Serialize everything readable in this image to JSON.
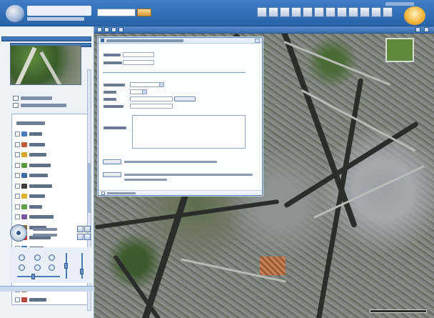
{
  "header": {
    "search_value": "",
    "search_go_label": "",
    "logo_icon": "earth-logo-icon",
    "tool_icons": [
      "map-tool-icon",
      "pencil-tool-icon",
      "layers-tool-icon",
      "print-tool-icon",
      "measure-tool-icon",
      "info-tool-icon",
      "route-tool-icon",
      "identify-tool-icon",
      "export-tool-icon",
      "help-tool-icon",
      "window-tool-icon",
      "settings-tool-icon"
    ]
  },
  "map_toolbar": {
    "buttons": [
      "first",
      "prev",
      "next",
      "last",
      "refresh",
      "close"
    ]
  },
  "sidebar": {
    "overview_title": "",
    "overview_options": [
      "",
      ""
    ],
    "layers_title": "",
    "layers": [
      {
        "icon": "home-icon",
        "color": "#4d7bbd"
      },
      {
        "icon": "building-icon",
        "color": "#c05b3a"
      },
      {
        "icon": "star-icon",
        "color": "#d9a42b"
      },
      {
        "icon": "flag-icon",
        "color": "#5a9a3c"
      },
      {
        "icon": "ship-icon",
        "color": "#3a6aa8"
      },
      {
        "icon": "plane-icon",
        "color": "#3d3d3d"
      },
      {
        "icon": "triangle-icon",
        "color": "#e0b233"
      },
      {
        "icon": "leaf-icon",
        "color": "#5fa04a"
      },
      {
        "icon": "tower-icon",
        "color": "#7a5a9e"
      },
      {
        "icon": "book-icon",
        "color": "#8b6a3a"
      },
      {
        "icon": "pin-icon",
        "color": "#c0392b"
      },
      {
        "icon": "car-icon",
        "color": "#3a7ab8"
      },
      {
        "icon": "tree-icon",
        "color": "#4e8a36"
      },
      {
        "icon": "water-icon",
        "color": "#2e86c1"
      },
      {
        "icon": "mountain-icon",
        "color": "#6f6f6f"
      },
      {
        "icon": "bridge-icon",
        "color": "#9a7b4f"
      },
      {
        "icon": "cross-icon",
        "color": "#b8483a"
      }
    ],
    "coords": [
      "",
      ""
    ],
    "bottom_tab": ""
  },
  "dialog": {
    "title": "",
    "latitude_label": "",
    "latitude_value": "",
    "longitude_label": "",
    "longitude_value": "",
    "category_label": "",
    "category_value": "",
    "level_label": "",
    "level_value": "",
    "image_label": "",
    "image_value": "",
    "browse_label": "",
    "optional_label": "",
    "description_label": "",
    "description_value": "",
    "upload_label": "",
    "upload_note": "",
    "submit_label": "",
    "submit_note": "",
    "footer_note": ""
  },
  "colors": {
    "header_blue": "#2a64a8",
    "sidebar_bg": "#eef3fa",
    "dialog_border": "#5a82b8"
  }
}
